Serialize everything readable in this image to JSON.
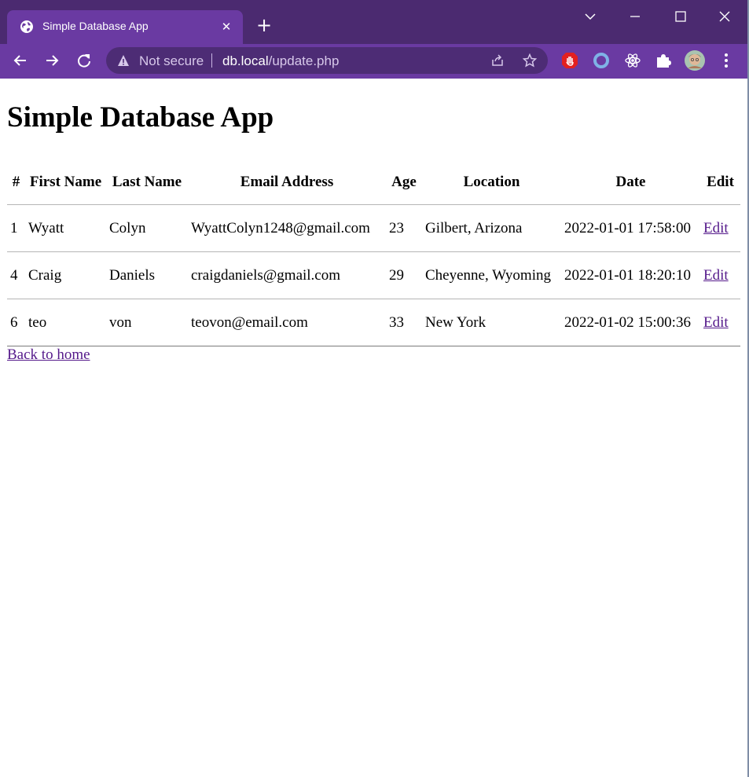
{
  "browser": {
    "tab_title": "Simple Database App",
    "security_label": "Not secure",
    "url_host": "db.local",
    "url_path": "/update.php",
    "icons": {
      "favicon": "globe-icon",
      "tab_close": "close-icon",
      "new_tab": "plus-icon",
      "tab_search": "chevron-down-icon",
      "minimize": "minimize-icon",
      "maximize": "maximize-icon",
      "close_window": "close-icon",
      "back": "arrow-left-icon",
      "forward": "arrow-right-icon",
      "reload": "reload-icon",
      "warning": "warning-icon",
      "share": "share-icon",
      "bookmark": "star-icon",
      "extensions": [
        "stop-hand-icon",
        "ring-icon",
        "react-atom-icon",
        "puzzle-icon"
      ],
      "profile": "avatar",
      "menu": "more-vertical-icon"
    },
    "colors": {
      "titlebar": "#4b2a70",
      "toolbar": "#6a3aa2",
      "omnibox": "#4d2c75"
    }
  },
  "page": {
    "title": "Simple Database App",
    "table": {
      "headers": [
        "#",
        "First Name",
        "Last Name",
        "Email Address",
        "Age",
        "Location",
        "Date",
        "Edit"
      ],
      "rows": [
        {
          "id": "1",
          "first": "Wyatt",
          "last": "Colyn",
          "email": "WyattColyn1248@gmail.com",
          "age": "23",
          "location": "Gilbert, Arizona",
          "date": "2022-01-01 17:58:00",
          "edit": "Edit"
        },
        {
          "id": "4",
          "first": "Craig",
          "last": "Daniels",
          "email": "craigdaniels@gmail.com",
          "age": "29",
          "location": "Cheyenne, Wyoming",
          "date": "2022-01-01 18:20:10",
          "edit": "Edit"
        },
        {
          "id": "6",
          "first": "teo",
          "last": "von",
          "email": "teovon@email.com",
          "age": "33",
          "location": "New York",
          "date": "2022-01-02 15:00:36",
          "edit": "Edit"
        }
      ]
    },
    "back_link": "Back to home",
    "link_color": "#551a8b"
  }
}
